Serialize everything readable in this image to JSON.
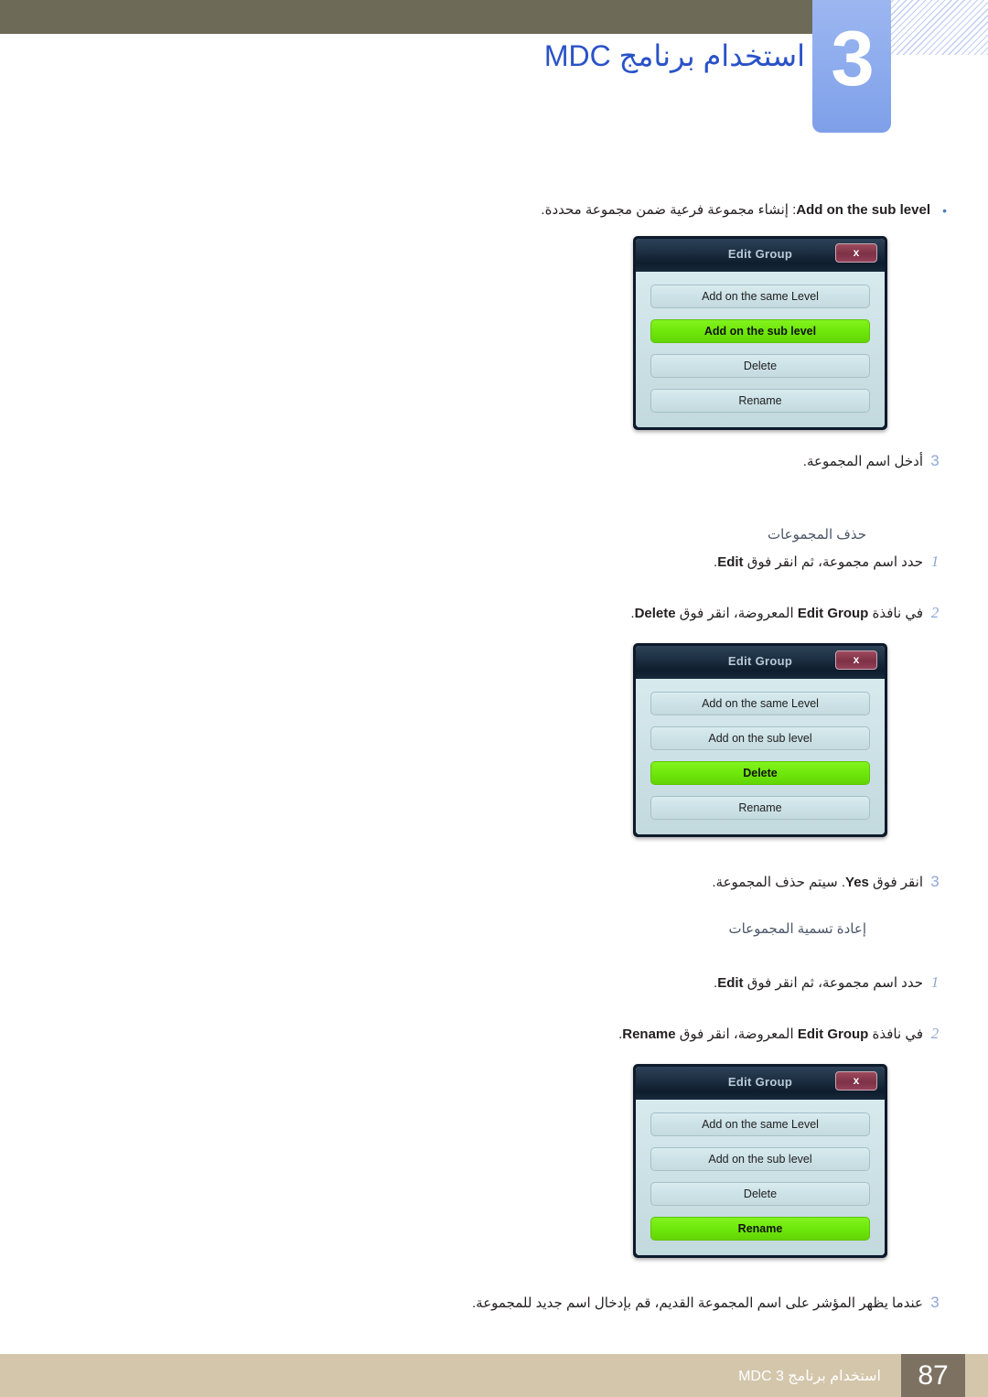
{
  "header": {
    "chapter_number": "3",
    "title": "استخدام برنامج MDC",
    "olive_bar_color": "#6d6a57",
    "tab_color": "#8fadee",
    "title_color": "#2a52c8"
  },
  "bullet": {
    "marker": "•",
    "term": "Add on the sub level",
    "separator": ":",
    "description": "إنشاء مجموعة فرعية ضمن مجموعة محددة."
  },
  "sections": [
    {
      "step_after_first_dialog": {
        "number": "3",
        "text": "أدخل اسم المجموعة."
      }
    },
    {
      "heading": "حذف المجموعات",
      "steps": [
        {
          "number": "1",
          "text_before": "حدد اسم مجموعة، ثم انقر فوق ",
          "en": "Edit",
          "text_after": "."
        },
        {
          "number": "2",
          "text_before": "في نافذة ",
          "en": "Edit Group",
          "text_mid": " المعروضة، انقر فوق ",
          "en2": "Delete",
          "text_after": "."
        },
        {
          "number": "3",
          "text_before": "انقر فوق ",
          "en": "Yes",
          "text_after": ". سيتم حذف المجموعة."
        }
      ]
    },
    {
      "heading": "إعادة تسمية المجموعات",
      "steps": [
        {
          "number": "1",
          "text_before": "حدد اسم مجموعة، ثم انقر فوق ",
          "en": "Edit",
          "text_after": "."
        },
        {
          "number": "2",
          "text_before": "في نافذة ",
          "en": "Edit Group",
          "text_mid": " المعروضة، انقر فوق ",
          "en2": "Rename",
          "text_after": "."
        },
        {
          "number": "3",
          "text": "عندما يظهر المؤشر على اسم المجموعة القديم، قم بإدخال اسم جديد للمجموعة."
        }
      ]
    }
  ],
  "dialogs": [
    {
      "title": "Edit Group",
      "close_label": "x",
      "buttons": [
        {
          "label": "Add on the same Level",
          "active": false
        },
        {
          "label": "Add on the sub level",
          "active": true
        },
        {
          "label": "Delete",
          "active": false
        },
        {
          "label": "Rename",
          "active": false
        }
      ]
    },
    {
      "title": "Edit Group",
      "close_label": "x",
      "buttons": [
        {
          "label": "Add on the same Level",
          "active": false
        },
        {
          "label": "Add on the sub level",
          "active": false
        },
        {
          "label": "Delete",
          "active": true
        },
        {
          "label": "Rename",
          "active": false
        }
      ]
    },
    {
      "title": "Edit Group",
      "close_label": "x",
      "buttons": [
        {
          "label": "Add on the same Level",
          "active": false
        },
        {
          "label": "Add on the sub level",
          "active": false
        },
        {
          "label": "Delete",
          "active": false
        },
        {
          "label": "Rename",
          "active": true
        }
      ]
    }
  ],
  "footer": {
    "text": "استخدام برنامج MDC 3",
    "page_number": "87",
    "bar_color": "#d3c6ab",
    "page_box_color": "#7d7261"
  },
  "highlight_color": "#6fe80a"
}
